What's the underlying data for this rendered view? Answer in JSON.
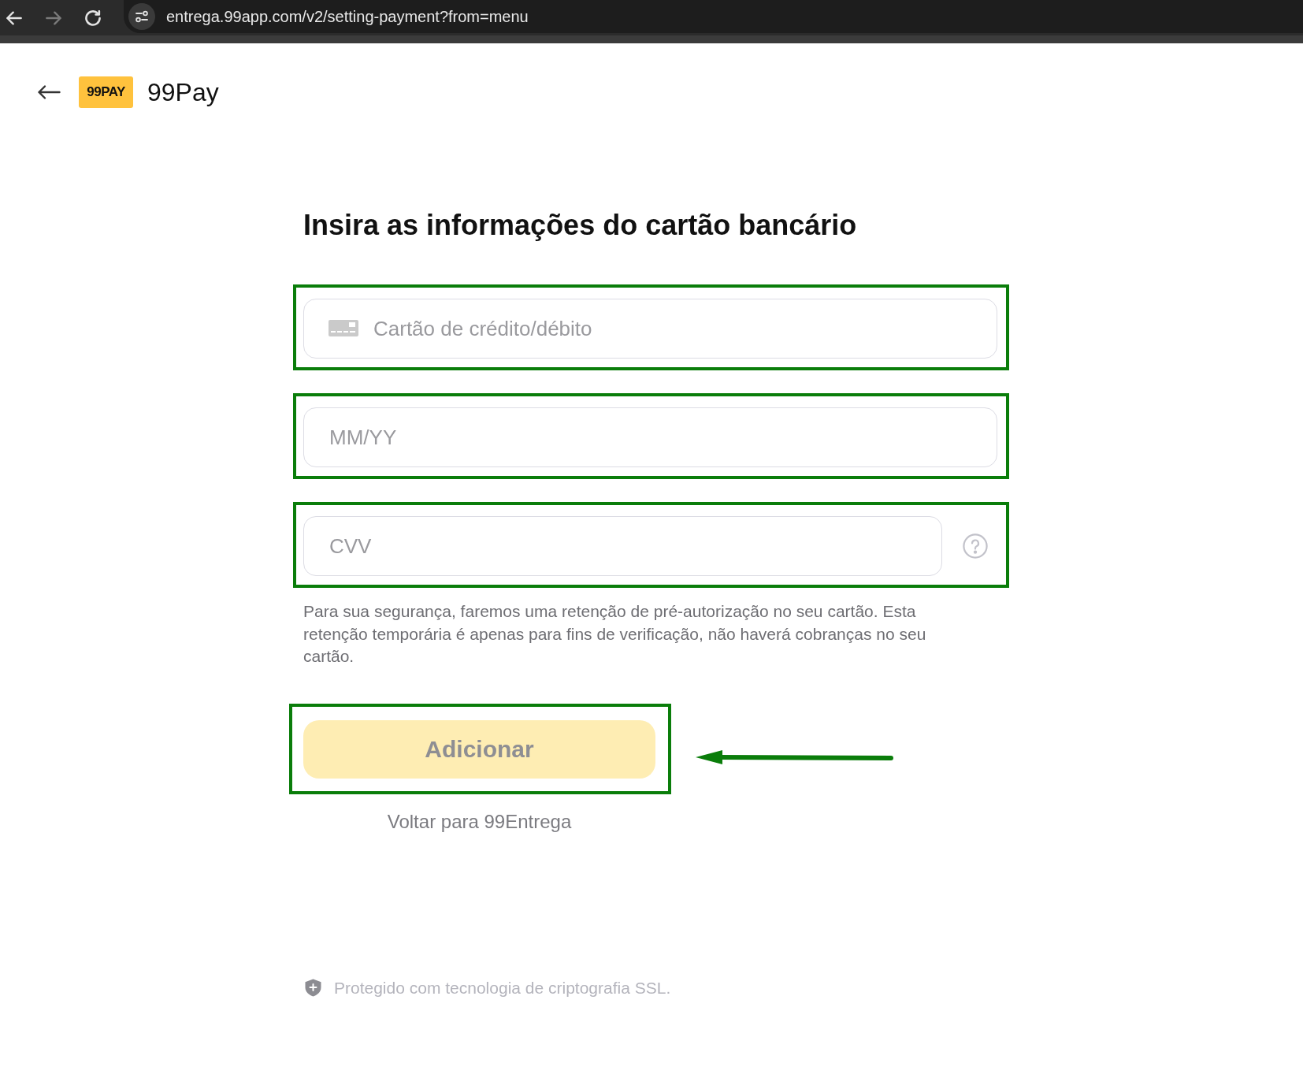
{
  "browser": {
    "nav": [
      {
        "kind": "back",
        "disabled": false
      },
      {
        "kind": "forward",
        "disabled": true
      },
      {
        "kind": "reload",
        "disabled": false
      }
    ],
    "url": "entrega.99app.com/v2/setting-payment?from=menu"
  },
  "header": {
    "logo_text": "99PAY",
    "title": "99Pay"
  },
  "heading": "Insira as informações do cartão bancário",
  "fields": [
    {
      "kind": "card",
      "placeholder": "Cartão de crédito/débito",
      "highlighted": true
    },
    {
      "kind": "expiry",
      "placeholder": "MM/YY",
      "highlighted": true
    },
    {
      "kind": "cvv",
      "placeholder": "CVV",
      "highlighted": true
    }
  ],
  "notice": "Para sua segurança, faremos uma retenção de pré-autorização no seu cartão. Esta retenção temporária é apenas para fins de verificação, não haverá cobranças no seu cartão.",
  "submit_button": {
    "label": "Adicionar",
    "disabled": true,
    "highlighted": true,
    "arrow": true
  },
  "back_link": "Voltar para 99Entrega",
  "footer": {
    "security_note": "Protegido com tecnologia de criptografia SSL."
  }
}
